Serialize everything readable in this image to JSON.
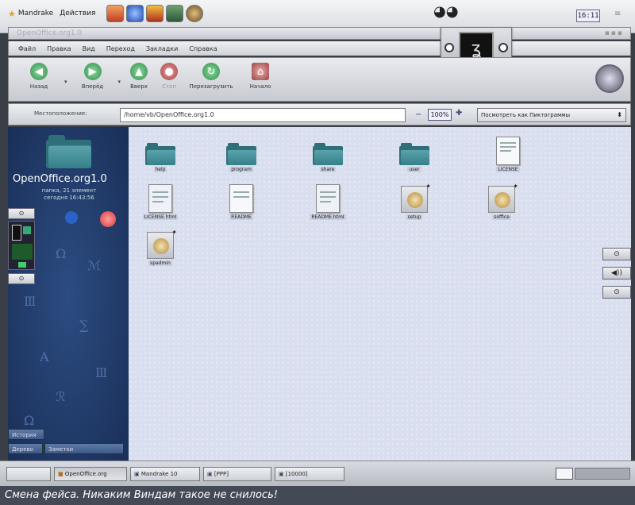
{
  "top_panel": {
    "menu_label": "Mandrake",
    "actions_label": "Действия",
    "clock": "16:11"
  },
  "window": {
    "title": "OpenOffice.org1.0"
  },
  "menubar": {
    "items": [
      "Файл",
      "Правка",
      "Вид",
      "Переход",
      "Закладки",
      "Справка"
    ]
  },
  "toolbar": {
    "back": "Назад",
    "forward": "Вперёд",
    "up": "Вверх",
    "stop": "Стоп",
    "reload": "Перезагрузить",
    "home": "Начало"
  },
  "location": {
    "label": "Местоположение:",
    "value": "/home/vb/OpenOffice.org1.0",
    "zoom": "100%",
    "view": "Посмотреть как Пиктограммы"
  },
  "sidebar": {
    "title": "OpenOffice.org1.0",
    "subtitle": "папка, 21 элемент",
    "date": "сегодня 16:43:56",
    "tabs": [
      "История",
      "Дерево",
      "Заметки"
    ]
  },
  "files": [
    {
      "name": "help",
      "type": "folder"
    },
    {
      "name": "program",
      "type": "folder"
    },
    {
      "name": "share",
      "type": "folder"
    },
    {
      "name": "user",
      "type": "folder"
    },
    {
      "name": "LICENSE",
      "type": "doc"
    },
    {
      "name": "LICENSE.html",
      "type": "doc"
    },
    {
      "name": "README",
      "type": "doc"
    },
    {
      "name": "README.html",
      "type": "doc"
    },
    {
      "name": "setup",
      "type": "pkg"
    },
    {
      "name": "soffice",
      "type": "pkg"
    },
    {
      "name": "spadmin",
      "type": "pkg"
    }
  ],
  "taskbar": {
    "tasks": [
      "OpenOffice.org",
      "Mandrake 10",
      "[PPP]",
      "[10000]"
    ]
  },
  "caption": "Смена фейса. Никаким Виндам такое не снилось!"
}
